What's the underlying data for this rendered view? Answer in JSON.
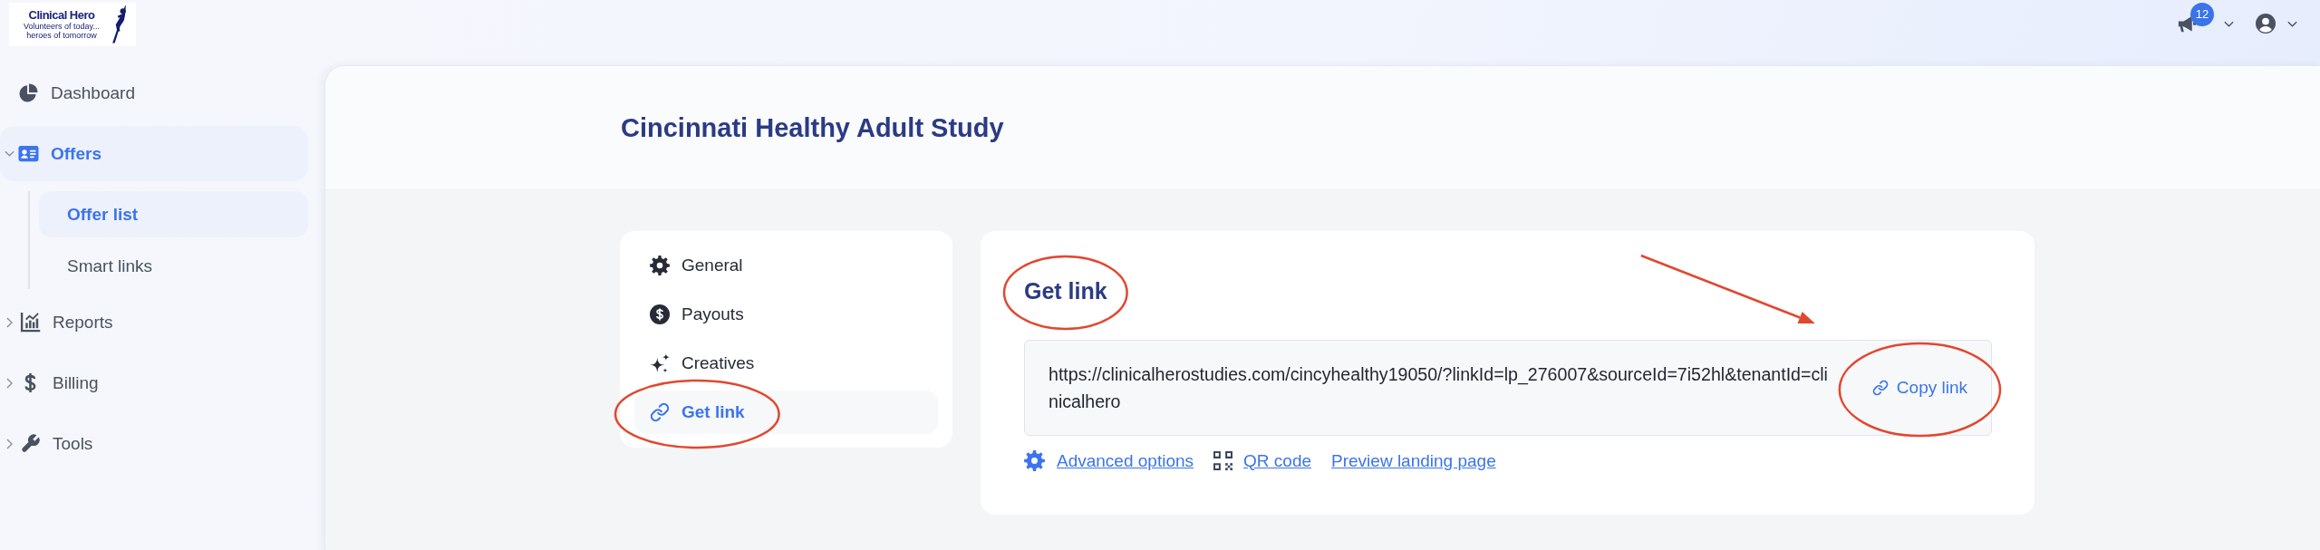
{
  "logo": {
    "name": "Clinical Hero",
    "tagline": [
      "Volunteers of today...",
      "heroes of tomorrow"
    ]
  },
  "topbar": {
    "notification_count": "12"
  },
  "sidebar": {
    "items": [
      {
        "label": "Dashboard",
        "kind": "link",
        "selected": false
      },
      {
        "label": "Offers",
        "kind": "group",
        "selected": true,
        "expanded": true,
        "children": [
          {
            "label": "Offer list",
            "selected": true
          },
          {
            "label": "Smart links",
            "selected": false
          }
        ]
      },
      {
        "label": "Reports",
        "kind": "group",
        "selected": false,
        "expanded": false
      },
      {
        "label": "Billing",
        "kind": "group",
        "selected": false,
        "expanded": false
      },
      {
        "label": "Tools",
        "kind": "group",
        "selected": false,
        "expanded": false
      }
    ]
  },
  "page": {
    "title": "Cincinnati Healthy Adult Study"
  },
  "settings_menu": {
    "items": [
      {
        "label": "General",
        "selected": false,
        "circled": false
      },
      {
        "label": "Payouts",
        "selected": false,
        "circled": false
      },
      {
        "label": "Creatives",
        "selected": false,
        "circled": false
      },
      {
        "label": "Get link",
        "selected": true,
        "circled": true
      }
    ]
  },
  "get_link": {
    "heading": {
      "text": "Get link",
      "circled": true
    },
    "url": "https://clinicalherostudies.com/cincyhealthy19050/?linkId=lp_276007&sourceId=7i52hl&tenantId=clinicalhero",
    "copy_button": {
      "label": "Copy link",
      "circled": true,
      "arrow": true
    },
    "links": [
      {
        "label": "Advanced options"
      },
      {
        "label": "QR code"
      },
      {
        "label": "Preview landing page"
      }
    ]
  }
}
